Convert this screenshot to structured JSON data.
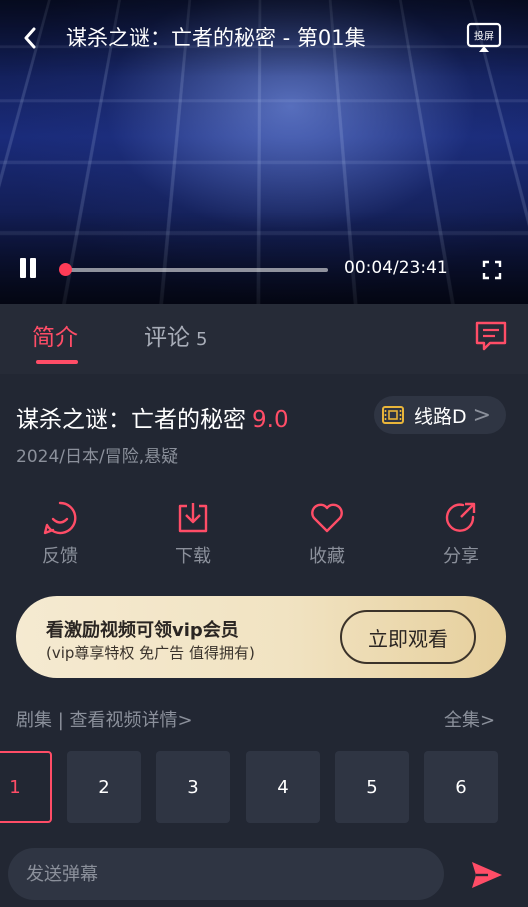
{
  "player": {
    "title": "谋杀之谜：亡者的秘密 - 第01集",
    "time": "00:04/23:41",
    "progress": 0.003,
    "cast_label": "投屏"
  },
  "tabs": [
    {
      "label": "简介",
      "active": true
    },
    {
      "label": "评论",
      "count": "5",
      "active": false
    }
  ],
  "movie": {
    "title": "谋杀之谜：亡者的秘密",
    "score": "9.0",
    "route_label": "线路D",
    "route_arrow": ">",
    "meta": "2024/日本/冒险,悬疑"
  },
  "actions": [
    {
      "label": "反馈",
      "icon": "smile-icon"
    },
    {
      "label": "下载",
      "icon": "download-icon"
    },
    {
      "label": "收藏",
      "icon": "heart-icon"
    },
    {
      "label": "分享",
      "icon": "share-icon"
    }
  ],
  "banner": {
    "title": "看激励视频可领vip会员",
    "subtitle": "(vip尊享特权 免广告 值得拥有)",
    "button": "立即观看"
  },
  "episodes": {
    "header": "剧集 | 查看视频详情>",
    "all_label": "全集>",
    "items": [
      "1",
      "2",
      "3",
      "4",
      "5",
      "6"
    ]
  },
  "danmaku": {
    "placeholder": "发送弹幕"
  },
  "colors": {
    "accent": "#ff4d67",
    "background": "#222733",
    "card": "#2f3543",
    "muted": "#8b909b"
  }
}
